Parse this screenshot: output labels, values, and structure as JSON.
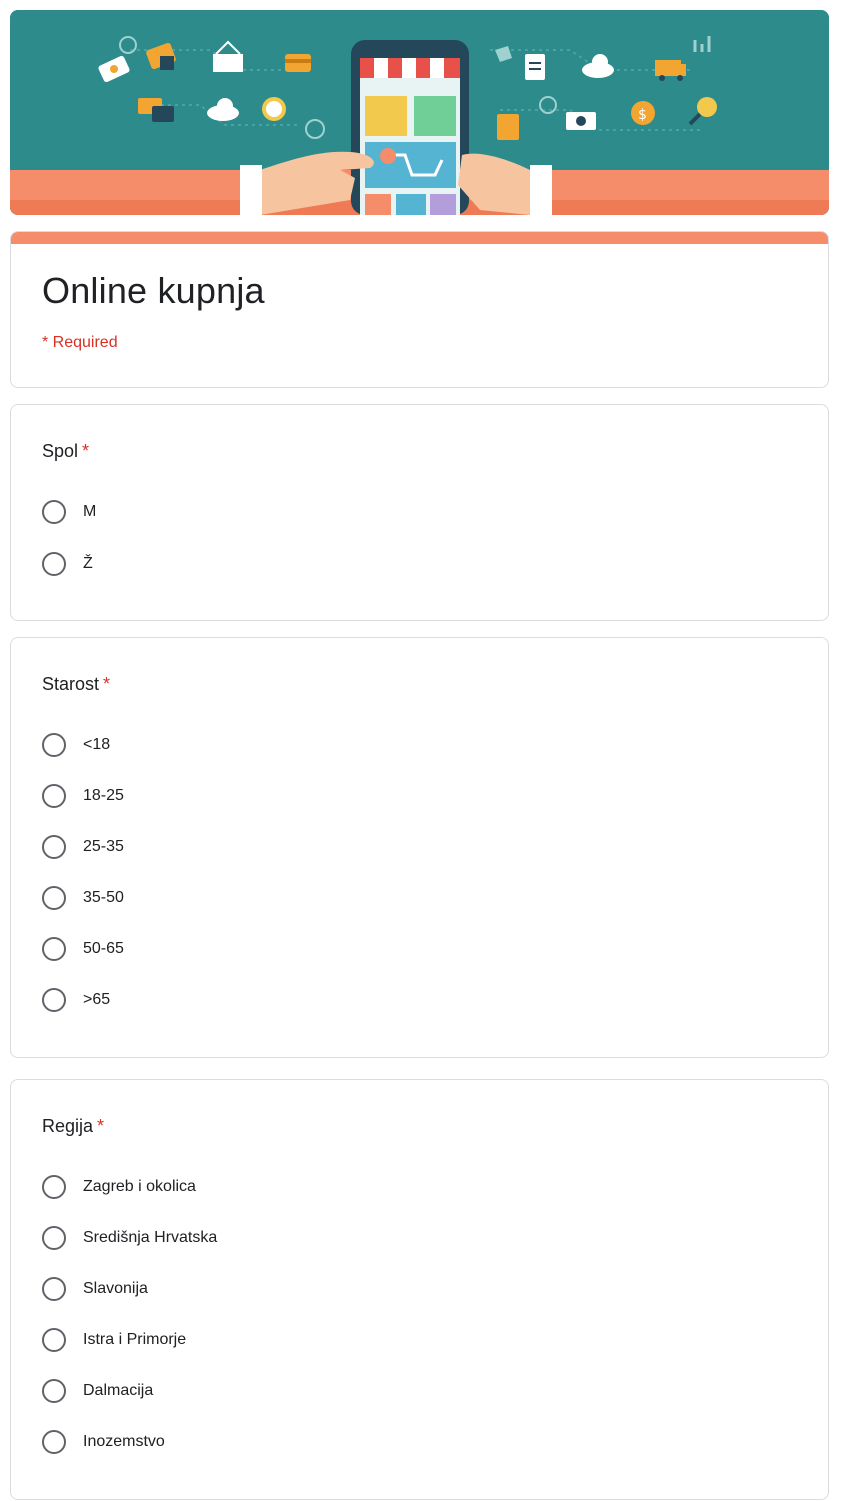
{
  "form": {
    "title": "Online kupnja",
    "required_note": "* Required"
  },
  "colors": {
    "accent": "#f58d6b",
    "banner_bg": "#2e8b8b",
    "required": "#d93025"
  },
  "questions": [
    {
      "title": "Spol",
      "required_mark": "*",
      "options": [
        "M",
        "Ž"
      ]
    },
    {
      "title": "Starost",
      "required_mark": "*",
      "options": [
        "<18",
        "18-25",
        "25-35",
        "35-50",
        "50-65",
        ">65"
      ]
    },
    {
      "title": "Regija",
      "required_mark": "*",
      "options": [
        "Zagreb i okolica",
        "Središnja Hrvatska",
        "Slavonija",
        "Istra i Primorje",
        "Dalmacija",
        "Inozemstvo"
      ]
    }
  ]
}
